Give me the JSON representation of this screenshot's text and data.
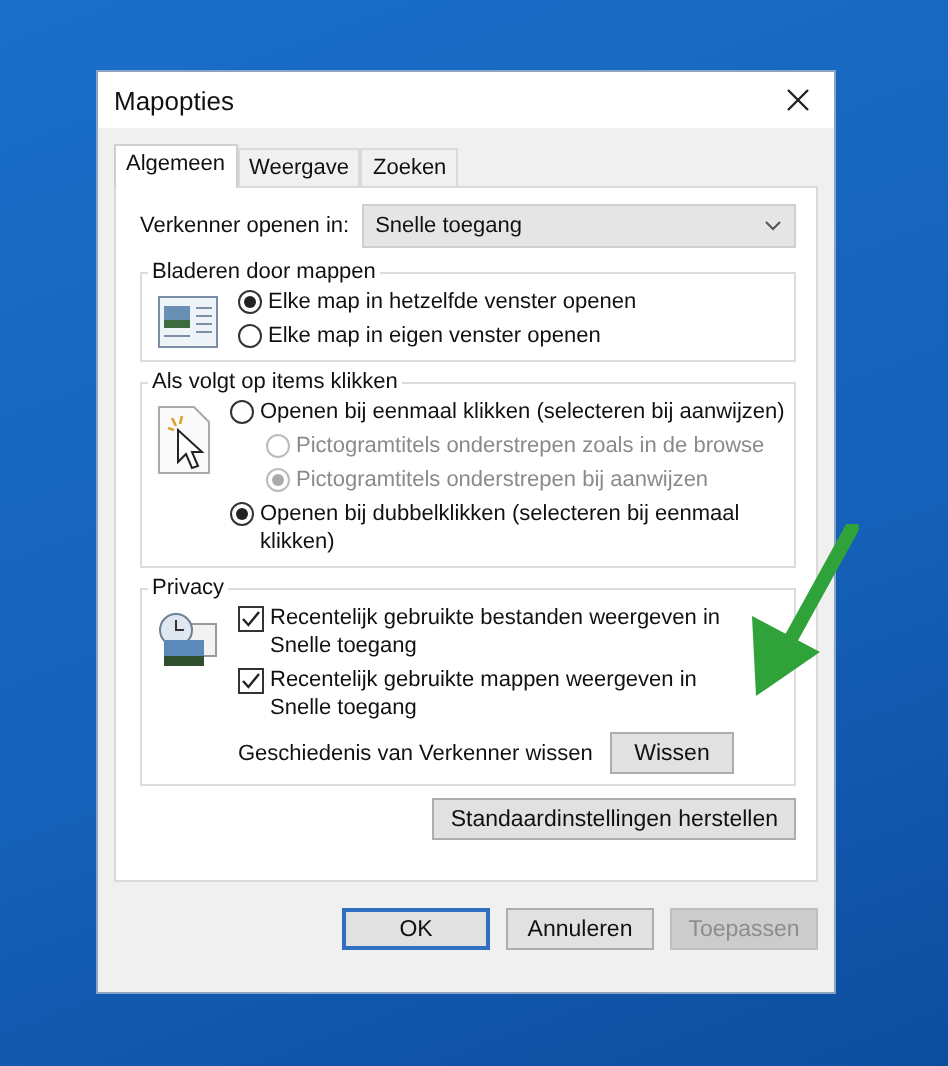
{
  "window": {
    "title": "Mapopties"
  },
  "tabs": [
    {
      "label": "Algemeen",
      "selected": true
    },
    {
      "label": "Weergave",
      "selected": false
    },
    {
      "label": "Zoeken",
      "selected": false
    }
  ],
  "open_in": {
    "label": "Verkenner openen in:",
    "value": "Snelle toegang"
  },
  "browse": {
    "title": "Bladeren door mappen",
    "options": [
      {
        "label": "Elke map in hetzelfde venster openen",
        "selected": true
      },
      {
        "label": "Elke map in eigen venster openen",
        "selected": false
      }
    ]
  },
  "click": {
    "title": "Als volgt op items klikken",
    "options": [
      {
        "label": "Openen bij eenmaal klikken (selecteren bij aanwijzen)",
        "selected": false,
        "disabled": false,
        "children": [
          {
            "label": "Pictogramtitels onderstrepen zoals in de browse",
            "selected": false,
            "disabled": true
          },
          {
            "label": "Pictogramtitels onderstrepen bij aanwijzen",
            "selected": true,
            "disabled": true
          }
        ]
      },
      {
        "label": "Openen bij dubbelklikken (selecteren bij eenmaal klikken)",
        "selected": true,
        "disabled": false
      }
    ]
  },
  "privacy": {
    "title": "Privacy",
    "checkboxes": [
      {
        "label": "Recentelijk gebruikte bestanden weergeven in Snelle toegang",
        "checked": true
      },
      {
        "label": "Recentelijk gebruikte mappen weergeven in Snelle toegang",
        "checked": true
      }
    ],
    "clear_label": "Geschiedenis van Verkenner wissen",
    "clear_button": "Wissen"
  },
  "restore_button": "Standaardinstellingen herstellen",
  "buttons": [
    {
      "label": "OK",
      "default": true,
      "disabled": false
    },
    {
      "label": "Annuleren",
      "default": false,
      "disabled": false
    },
    {
      "label": "Toepassen",
      "default": false,
      "disabled": true
    }
  ]
}
